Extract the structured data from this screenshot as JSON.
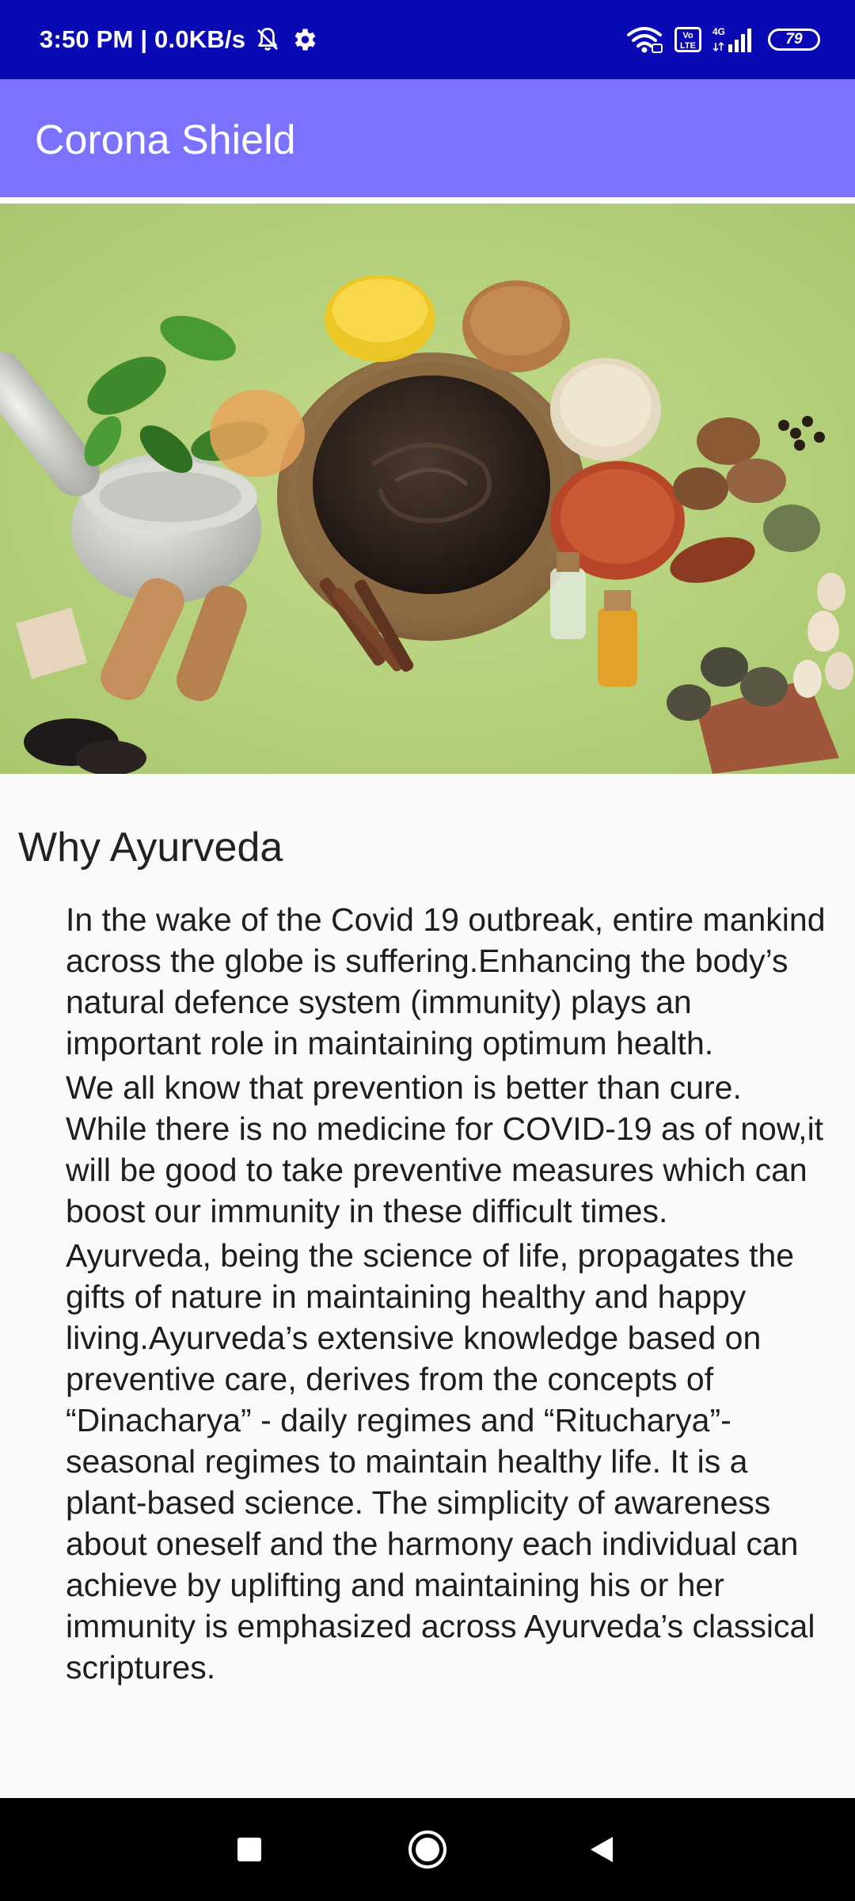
{
  "status_bar": {
    "time_speed": "3:50 PM | 0.0KB/s",
    "network_type": "4G",
    "volte_label": "Vo LTE",
    "battery_level": "79",
    "icons": [
      "bell-off-icon",
      "gear-icon",
      "wifi-icon",
      "volte-icon",
      "signal-icon",
      "battery-icon"
    ]
  },
  "app_bar": {
    "title": "Corona Shield"
  },
  "hero_image": {
    "description": "ayurvedic herbs and spices around a bowl"
  },
  "article": {
    "heading": "Why Ayurveda",
    "paragraphs": [
      "In the wake of the Covid 19 outbreak, entire mankind across the globe is suffering.Enhancing the body’s natural defence system (immunity) plays an important role in maintaining optimum health.",
      "We all know that prevention is better than cure. While there is no medicine for COVID-19 as of now,it will be good to take preventive measures which can boost our immunity in these difficult times.",
      "Ayurveda, being the science of life, propagates the gifts of nature in maintaining healthy and happy living.Ayurveda’s extensive knowledge based on preventive care, derives from the concepts of “Dinacharya” - daily regimes and “Ritucharya”- seasonal regimes to maintain healthy life. It is a plant-based science. The simplicity of awareness about oneself and the harmony each individual can achieve by uplifting and maintaining his or her immunity is emphasized across Ayurveda’s classical scriptures."
    ]
  },
  "nav_bar": {
    "buttons": [
      "recents-square-icon",
      "home-circle-icon",
      "back-triangle-icon"
    ]
  },
  "colors": {
    "status_bar_bg": "#0a0ab4",
    "app_bar_bg": "#7b72ff",
    "page_bg": "#fafafa",
    "nav_bar_bg": "#000000"
  }
}
